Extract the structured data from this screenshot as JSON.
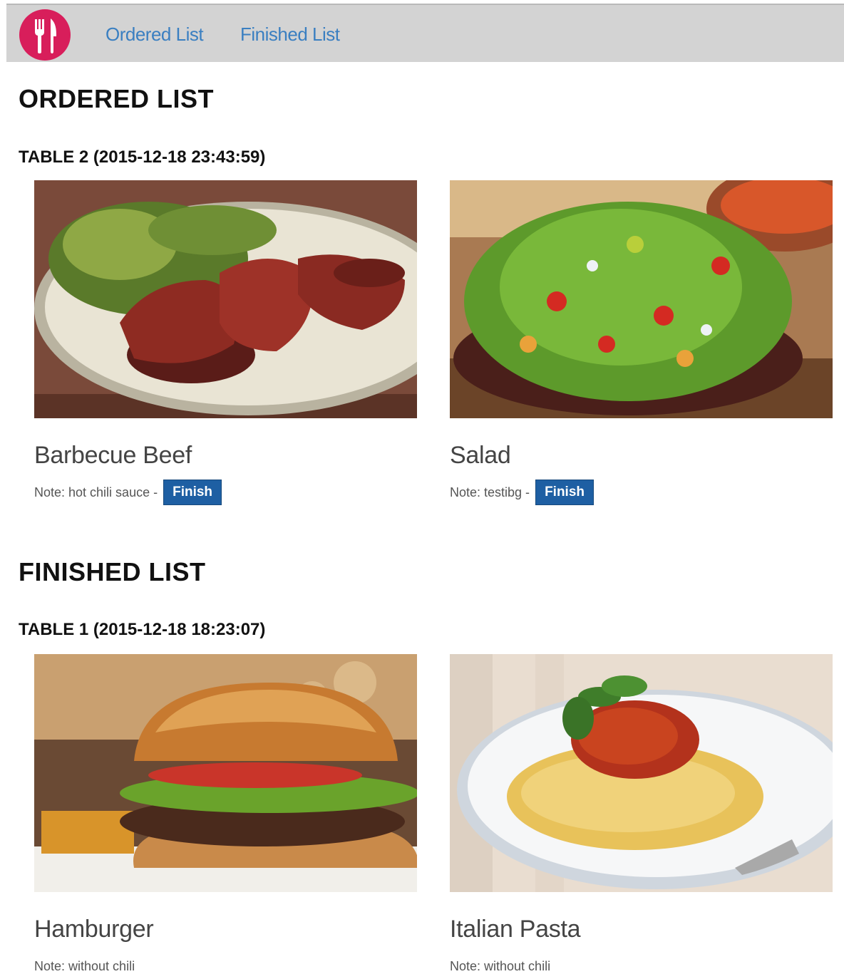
{
  "nav": {
    "links": [
      "Ordered List",
      "Finished List"
    ]
  },
  "ordered": {
    "title": "ORDERED LIST",
    "table_label": "TABLE 2 (2015-12-18 23:43:59)",
    "items": [
      {
        "name": "Barbecue Beef",
        "note": "Note: hot chili sauce -",
        "button": "Finish"
      },
      {
        "name": "Salad",
        "note": "Note: testibg -",
        "button": "Finish"
      }
    ]
  },
  "finished": {
    "title": "FINISHED LIST",
    "table_label": "TABLE 1 (2015-12-18 18:23:07)",
    "items": [
      {
        "name": "Hamburger",
        "note": "Note: without chili"
      },
      {
        "name": "Italian Pasta",
        "note": "Note: without chili"
      }
    ]
  },
  "colors": {
    "brand": "#d81e5b",
    "link": "#3a7fc1",
    "button": "#1e5fa3",
    "navbar": "#d3d3d3"
  },
  "icons": {
    "logo": "fork-knife-icon"
  }
}
